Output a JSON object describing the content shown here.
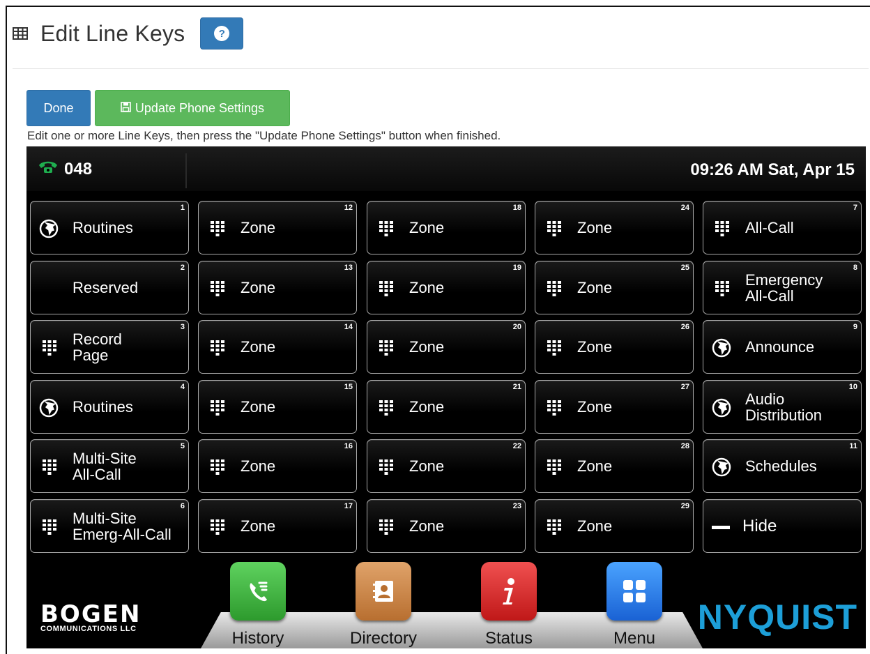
{
  "header": {
    "title": "Edit Line Keys",
    "help_label": "?"
  },
  "toolbar": {
    "done_label": "Done",
    "update_label": "Update Phone Settings",
    "instructions": "Edit one or more Line Keys, then press the \"Update Phone Settings\" button when finished."
  },
  "phone": {
    "extension": "048",
    "clock": "09:26 AM Sat, Apr 15",
    "colors": {
      "accent_phone": "#1fae4f",
      "nyquist": "#1d9fd8"
    },
    "keys": [
      {
        "num": "1",
        "icon": "globe-icon",
        "line1": "Routines",
        "line2": ""
      },
      {
        "num": "12",
        "icon": "keypad-icon",
        "line1": "Zone",
        "line2": ""
      },
      {
        "num": "18",
        "icon": "keypad-icon",
        "line1": "Zone",
        "line2": ""
      },
      {
        "num": "24",
        "icon": "keypad-icon",
        "line1": "Zone",
        "line2": ""
      },
      {
        "num": "7",
        "icon": "keypad-icon",
        "line1": "All-Call",
        "line2": ""
      },
      {
        "num": "2",
        "icon": "",
        "line1": "Reserved",
        "line2": ""
      },
      {
        "num": "13",
        "icon": "keypad-icon",
        "line1": "Zone",
        "line2": ""
      },
      {
        "num": "19",
        "icon": "keypad-icon",
        "line1": "Zone",
        "line2": ""
      },
      {
        "num": "25",
        "icon": "keypad-icon",
        "line1": "Zone",
        "line2": ""
      },
      {
        "num": "8",
        "icon": "keypad-icon",
        "line1": "Emergency",
        "line2": "All-Call"
      },
      {
        "num": "3",
        "icon": "keypad-icon",
        "line1": "Record",
        "line2": "Page"
      },
      {
        "num": "14",
        "icon": "keypad-icon",
        "line1": "Zone",
        "line2": ""
      },
      {
        "num": "20",
        "icon": "keypad-icon",
        "line1": "Zone",
        "line2": ""
      },
      {
        "num": "26",
        "icon": "keypad-icon",
        "line1": "Zone",
        "line2": ""
      },
      {
        "num": "9",
        "icon": "globe-icon",
        "line1": "Announce",
        "line2": ""
      },
      {
        "num": "4",
        "icon": "globe-icon",
        "line1": "Routines",
        "line2": ""
      },
      {
        "num": "15",
        "icon": "keypad-icon",
        "line1": "Zone",
        "line2": ""
      },
      {
        "num": "21",
        "icon": "keypad-icon",
        "line1": "Zone",
        "line2": ""
      },
      {
        "num": "27",
        "icon": "keypad-icon",
        "line1": "Zone",
        "line2": ""
      },
      {
        "num": "10",
        "icon": "globe-icon",
        "line1": "Audio",
        "line2": "Distribution"
      },
      {
        "num": "5",
        "icon": "keypad-icon",
        "line1": "Multi-Site",
        "line2": "All-Call"
      },
      {
        "num": "16",
        "icon": "keypad-icon",
        "line1": "Zone",
        "line2": ""
      },
      {
        "num": "22",
        "icon": "keypad-icon",
        "line1": "Zone",
        "line2": ""
      },
      {
        "num": "28",
        "icon": "keypad-icon",
        "line1": "Zone",
        "line2": ""
      },
      {
        "num": "11",
        "icon": "globe-icon",
        "line1": "Schedules",
        "line2": ""
      },
      {
        "num": "6",
        "icon": "keypad-icon",
        "line1": "Multi-Site",
        "line2": "Emerg-All-Call"
      },
      {
        "num": "17",
        "icon": "keypad-icon",
        "line1": "Zone",
        "line2": ""
      },
      {
        "num": "23",
        "icon": "keypad-icon",
        "line1": "Zone",
        "line2": ""
      },
      {
        "num": "29",
        "icon": "keypad-icon",
        "line1": "Zone",
        "line2": ""
      },
      {
        "num": "",
        "icon": "minus-icon",
        "line1": "Hide",
        "line2": ""
      }
    ],
    "dock": {
      "history": "History",
      "directory": "Directory",
      "status": "Status",
      "menu": "Menu"
    },
    "branding": {
      "bogen": "BOGEN",
      "bogen_sub": "COMMUNICATIONS LLC",
      "nyquist": "NYQUIST"
    }
  }
}
